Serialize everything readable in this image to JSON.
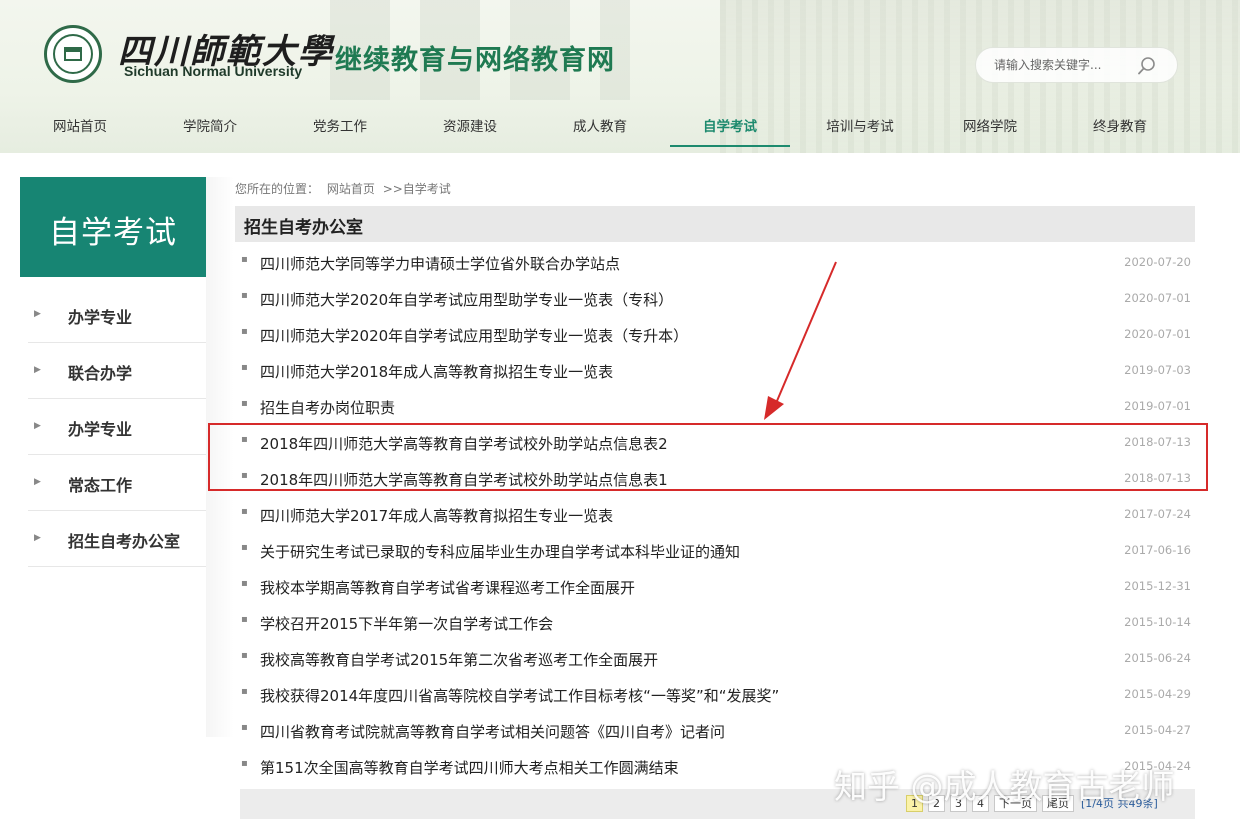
{
  "header": {
    "university_cn": "四川師範大學",
    "university_en": "Sichuan Normal University",
    "site_title": "继续教育与网络教育网",
    "search_placeholder": "请输入搜索关键字..."
  },
  "nav": {
    "items": [
      {
        "label": "网站首页"
      },
      {
        "label": "学院简介"
      },
      {
        "label": "党务工作"
      },
      {
        "label": "资源建设"
      },
      {
        "label": "成人教育"
      },
      {
        "label": "自学考试"
      },
      {
        "label": "培训与考试"
      },
      {
        "label": "网络学院"
      },
      {
        "label": "终身教育"
      }
    ],
    "active": "自学考试"
  },
  "sidebar": {
    "title": "自学考试",
    "items": [
      {
        "label": "办学专业"
      },
      {
        "label": "联合办学"
      },
      {
        "label": "办学专业"
      },
      {
        "label": "常态工作"
      },
      {
        "label": "招生自考办公室"
      }
    ]
  },
  "breadcrumb": {
    "prefix": "您所在的位置：",
    "home": "网站首页",
    "current": ">>自学考试"
  },
  "section": {
    "title": "招生自考办公室"
  },
  "articles": [
    {
      "title": "四川师范大学同等学力申请硕士学位省外联合办学站点",
      "date": "2020-07-20"
    },
    {
      "title": "四川师范大学2020年自学考试应用型助学专业一览表（专科）",
      "date": "2020-07-01"
    },
    {
      "title": "四川师范大学2020年自学考试应用型助学专业一览表（专升本）",
      "date": "2020-07-01"
    },
    {
      "title": "四川师范大学2018年成人高等教育拟招生专业一览表",
      "date": "2019-07-03"
    },
    {
      "title": "招生自考办岗位职责",
      "date": "2019-07-01"
    },
    {
      "title": "2018年四川师范大学高等教育自学考试校外助学站点信息表2",
      "date": "2018-07-13"
    },
    {
      "title": "2018年四川师范大学高等教育自学考试校外助学站点信息表1",
      "date": "2018-07-13"
    },
    {
      "title": "四川师范大学2017年成人高等教育拟招生专业一览表",
      "date": "2017-07-24"
    },
    {
      "title": "关于研究生考试已录取的专科应届毕业生办理自学考试本科毕业证的通知",
      "date": "2017-06-16"
    },
    {
      "title": "我校本学期高等教育自学考试省考课程巡考工作全面展开",
      "date": "2015-12-31"
    },
    {
      "title": "学校召开2015下半年第一次自学考试工作会",
      "date": "2015-10-14"
    },
    {
      "title": "我校高等教育自学考试2015年第二次省考巡考工作全面展开",
      "date": "2015-06-24"
    },
    {
      "title": "我校获得2014年度四川省高等院校自学考试工作目标考核“一等奖”和“发展奖”",
      "date": "2015-04-29"
    },
    {
      "title": "四川省教育考试院就高等教育自学考试相关问题答《四川自考》记者问",
      "date": "2015-04-27"
    },
    {
      "title": "第151次全国高等教育自学考试四川师大考点相关工作圆满结束",
      "date": "2015-04-24"
    }
  ],
  "pagination": {
    "pages": [
      "1",
      "2",
      "3",
      "4"
    ],
    "current": "1",
    "next": "下一页",
    "last": "尾页",
    "info": "[1/4页 共49条]"
  },
  "watermark": "知乎 @成人教育古老师",
  "colors": {
    "accent": "#178573",
    "highlight": "#d62a2a"
  }
}
